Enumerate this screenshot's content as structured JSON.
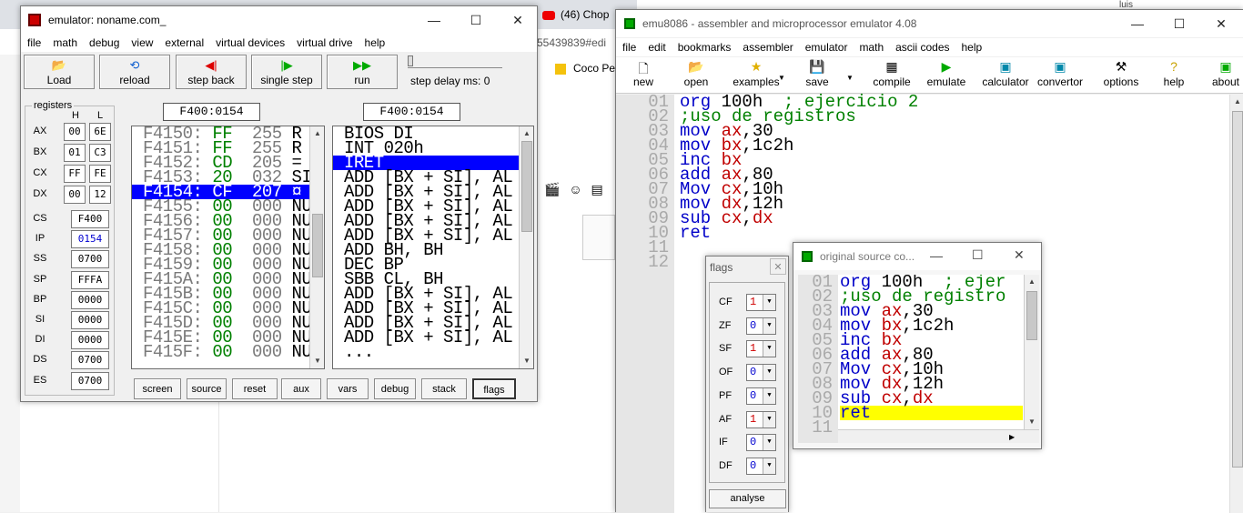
{
  "background": {
    "tabs": [
      {
        "label": "(46) Chop"
      },
      {
        "label": "luis"
      }
    ],
    "url_fragment": "55439839#edi",
    "bookmark": "Coco Pe"
  },
  "emulator": {
    "title": "emulator: noname.com_",
    "menu": [
      "file",
      "math",
      "debug",
      "view",
      "external",
      "virtual devices",
      "virtual drive",
      "help"
    ],
    "toolbar": {
      "load": "Load",
      "reload": "reload",
      "step_back": "step back",
      "single_step": "single step",
      "run": "run",
      "step_delay": "step delay ms: 0"
    },
    "registers_label": "registers",
    "h_label": "H",
    "l_label": "L",
    "gp_registers": [
      {
        "name": "AX",
        "h": "00",
        "l": "6E"
      },
      {
        "name": "BX",
        "h": "01",
        "l": "C3"
      },
      {
        "name": "CX",
        "h": "FF",
        "l": "FE"
      },
      {
        "name": "DX",
        "h": "00",
        "l": "12"
      }
    ],
    "seg_registers": [
      {
        "name": "CS",
        "value": "F400",
        "highlight": false
      },
      {
        "name": "IP",
        "value": "0154",
        "highlight": true
      },
      {
        "name": "SS",
        "value": "0700",
        "highlight": false
      },
      {
        "name": "SP",
        "value": "FFFA",
        "highlight": false
      },
      {
        "name": "BP",
        "value": "0000",
        "highlight": false
      },
      {
        "name": "SI",
        "value": "0000",
        "highlight": false
      },
      {
        "name": "DI",
        "value": "0000",
        "highlight": false
      },
      {
        "name": "DS",
        "value": "0700",
        "highlight": false
      },
      {
        "name": "ES",
        "value": "0700",
        "highlight": false
      }
    ],
    "mem_address": "F400:0154",
    "dis_address": "F400:0154",
    "memory": [
      {
        "addr": "F4150:",
        "hex": "FF",
        "dec": "255",
        "ch": "R"
      },
      {
        "addr": "F4151:",
        "hex": "FF",
        "dec": "255",
        "ch": "R"
      },
      {
        "addr": "F4152:",
        "hex": "CD",
        "dec": "205",
        "ch": "="
      },
      {
        "addr": "F4153:",
        "hex": "20",
        "dec": "032",
        "ch": "SI"
      },
      {
        "addr": "F4154:",
        "hex": "CF",
        "dec": "207",
        "ch": "¤",
        "sel": true
      },
      {
        "addr": "F4155:",
        "hex": "00",
        "dec": "000",
        "ch": "NU"
      },
      {
        "addr": "F4156:",
        "hex": "00",
        "dec": "000",
        "ch": "NU"
      },
      {
        "addr": "F4157:",
        "hex": "00",
        "dec": "000",
        "ch": "NU"
      },
      {
        "addr": "F4158:",
        "hex": "00",
        "dec": "000",
        "ch": "NU"
      },
      {
        "addr": "F4159:",
        "hex": "00",
        "dec": "000",
        "ch": "NU"
      },
      {
        "addr": "F415A:",
        "hex": "00",
        "dec": "000",
        "ch": "NU"
      },
      {
        "addr": "F415B:",
        "hex": "00",
        "dec": "000",
        "ch": "NU"
      },
      {
        "addr": "F415C:",
        "hex": "00",
        "dec": "000",
        "ch": "NU"
      },
      {
        "addr": "F415D:",
        "hex": "00",
        "dec": "000",
        "ch": "NU"
      },
      {
        "addr": "F415E:",
        "hex": "00",
        "dec": "000",
        "ch": "NU"
      },
      {
        "addr": "F415F:",
        "hex": "00",
        "dec": "000",
        "ch": "NU"
      }
    ],
    "disasm": [
      {
        "text": "BIOS DI"
      },
      {
        "text": "INT 020h"
      },
      {
        "text": "IRET",
        "sel": true
      },
      {
        "text": "ADD [BX + SI], AL"
      },
      {
        "text": "ADD [BX + SI], AL"
      },
      {
        "text": "ADD [BX + SI], AL"
      },
      {
        "text": "ADD [BX + SI], AL"
      },
      {
        "text": "ADD [BX + SI], AL"
      },
      {
        "text": "ADD BH, BH"
      },
      {
        "text": "DEC BP"
      },
      {
        "text": "SBB CL, BH"
      },
      {
        "text": "ADD [BX + SI], AL"
      },
      {
        "text": "ADD [BX + SI], AL"
      },
      {
        "text": "ADD [BX + SI], AL"
      },
      {
        "text": "ADD [BX + SI], AL"
      },
      {
        "text": "..."
      }
    ],
    "bottom_buttons": [
      "screen",
      "source",
      "reset",
      "aux",
      "vars",
      "debug",
      "stack",
      "flags"
    ]
  },
  "editor": {
    "title": "emu8086 - assembler and microprocessor emulator 4.08",
    "menu": [
      "file",
      "edit",
      "bookmarks",
      "assembler",
      "emulator",
      "math",
      "ascii codes",
      "help"
    ],
    "toolbar": [
      "new",
      "open",
      "examples",
      "save",
      "compile",
      "emulate",
      "calculator",
      "convertor",
      "options",
      "help",
      "about"
    ],
    "lines": [
      [
        [
          "kw",
          "org"
        ],
        [
          "num",
          " 100h  "
        ],
        [
          "cmt",
          "; ejercicio 2"
        ]
      ],
      [
        [
          "cmt",
          ";uso de registros"
        ]
      ],
      [
        [
          "kw",
          "mov"
        ],
        [
          "num",
          " "
        ],
        [
          "reg",
          "ax"
        ],
        [
          "num",
          ",30"
        ]
      ],
      [
        [
          "kw",
          "mov"
        ],
        [
          "num",
          " "
        ],
        [
          "reg",
          "bx"
        ],
        [
          "num",
          ",1c2h"
        ]
      ],
      [
        [
          "kw",
          "inc"
        ],
        [
          "num",
          " "
        ],
        [
          "reg",
          "bx"
        ]
      ],
      [
        [
          "kw",
          "add"
        ],
        [
          "num",
          " "
        ],
        [
          "reg",
          "ax"
        ],
        [
          "num",
          ",80"
        ]
      ],
      [
        [
          "kw",
          "Mov"
        ],
        [
          "num",
          " "
        ],
        [
          "reg",
          "cx"
        ],
        [
          "num",
          ",10h"
        ]
      ],
      [
        [
          "kw",
          "mov"
        ],
        [
          "num",
          " "
        ],
        [
          "reg",
          "dx"
        ],
        [
          "num",
          ",12h"
        ]
      ],
      [
        [
          "kw",
          "sub"
        ],
        [
          "num",
          " "
        ],
        [
          "reg",
          "cx"
        ],
        [
          "num",
          ","
        ],
        [
          "reg",
          "dx"
        ]
      ],
      [
        [
          "kw",
          "ret"
        ]
      ],
      [],
      []
    ],
    "line_numbers": [
      "01",
      "02",
      "03",
      "04",
      "05",
      "06",
      "07",
      "08",
      "09",
      "10",
      "11",
      "12"
    ]
  },
  "flags_window": {
    "title": "flags",
    "flags": [
      {
        "name": "CF",
        "value": "1",
        "on": true
      },
      {
        "name": "ZF",
        "value": "0",
        "on": false
      },
      {
        "name": "SF",
        "value": "1",
        "on": true
      },
      {
        "name": "OF",
        "value": "0",
        "on": false
      },
      {
        "name": "PF",
        "value": "0",
        "on": false
      },
      {
        "name": "AF",
        "value": "1",
        "on": true
      },
      {
        "name": "IF",
        "value": "0",
        "on": false
      },
      {
        "name": "DF",
        "value": "0",
        "on": false
      }
    ],
    "analyse": "analyse"
  },
  "source_window": {
    "title": "original source co...",
    "line_numbers": [
      "01",
      "02",
      "03",
      "04",
      "05",
      "06",
      "07",
      "08",
      "09",
      "10",
      "11"
    ],
    "lines": [
      [
        [
          "kw",
          "org"
        ],
        [
          "num",
          " 100h  "
        ],
        [
          "cmt",
          "; ejer"
        ]
      ],
      [
        [
          "cmt",
          ";uso de registro"
        ]
      ],
      [
        [
          "kw",
          "mov"
        ],
        [
          "num",
          " "
        ],
        [
          "reg",
          "ax"
        ],
        [
          "num",
          ",30"
        ]
      ],
      [
        [
          "kw",
          "mov"
        ],
        [
          "num",
          " "
        ],
        [
          "reg",
          "bx"
        ],
        [
          "num",
          ",1c2h"
        ]
      ],
      [
        [
          "kw",
          "inc"
        ],
        [
          "num",
          " "
        ],
        [
          "reg",
          "bx"
        ]
      ],
      [
        [
          "kw",
          "add"
        ],
        [
          "num",
          " "
        ],
        [
          "reg",
          "ax"
        ],
        [
          "num",
          ",80"
        ]
      ],
      [
        [
          "kw",
          "Mov"
        ],
        [
          "num",
          " "
        ],
        [
          "reg",
          "cx"
        ],
        [
          "num",
          ",10h"
        ]
      ],
      [
        [
          "kw",
          "mov"
        ],
        [
          "num",
          " "
        ],
        [
          "reg",
          "dx"
        ],
        [
          "num",
          ",12h"
        ]
      ],
      [
        [
          "kw",
          "sub"
        ],
        [
          "num",
          " "
        ],
        [
          "reg",
          "cx"
        ],
        [
          "num",
          ","
        ],
        [
          "reg",
          "dx"
        ]
      ],
      [
        [
          "kw",
          "ret"
        ]
      ],
      []
    ],
    "highlight_line": 9
  },
  "colors": {
    "selection": "#0000ff",
    "keyword": "#0000c8",
    "register": "#c00000",
    "comment": "#008000",
    "memory_hex": "#008000",
    "exec_highlight": "#ffff00"
  }
}
